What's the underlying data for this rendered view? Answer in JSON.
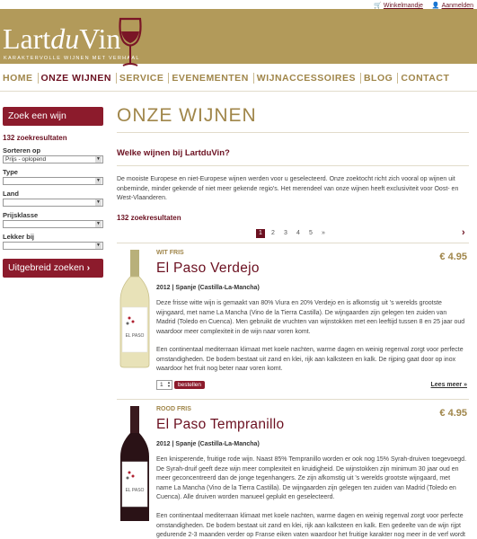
{
  "toplinks": {
    "cart": "Winkelmandje",
    "login": "Aanmelden"
  },
  "logo": {
    "part1": "Lart",
    "part2": "du",
    "part3": "Vin",
    "tagline": "KARAKTERVOLLE WIJNEN MET VERHAAL"
  },
  "nav": [
    "HOME",
    "ONZE WIJNEN",
    "SERVICE",
    "EVENEMENTEN",
    "WIJNACCESSOIRES",
    "BLOG",
    "CONTACT"
  ],
  "nav_active": "ONZE WIJNEN",
  "sidebar": {
    "search_title": "Zoek een wijn",
    "count": "132 zoekresultaten",
    "sort_label": "Sorteren op",
    "sort_value": "Prijs - oplopend",
    "type_label": "Type",
    "land_label": "Land",
    "price_label": "Prijsklasse",
    "lekker_label": "Lekker bij",
    "advanced_button": "Uitgebreid zoeken"
  },
  "main": {
    "title": "ONZE WIJNEN",
    "subtitle": "Welke wijnen bij LartduVin?",
    "intro": "De mooiste Europese en niet-Europese wijnen werden voor u geselecteerd. Onze zoektocht richt zich vooral op wijnen uit onbeminde, minder gekende of niet meer gekende regio's. Het merendeel van onze wijnen heeft exclusiviteit voor Oost- en West-Vlaanderen.",
    "count": "132 zoekresultaten",
    "pages": [
      "1",
      "2",
      "3",
      "4",
      "5",
      "»"
    ],
    "current_page": "1",
    "next_arrow": "›"
  },
  "wines": [
    {
      "category": "WIT FRIS",
      "name": "El Paso Verdejo",
      "price": "€ 4.95",
      "meta": "2012 | Spanje (Castilla-La-Mancha)",
      "desc1": "Deze frisse witte wijn is gemaakt van 80% Viura en 20% Verdejo en is afkomstig uit 's werelds grootste wijngaard, met name La Mancha (Vino de la Tierra Castilla). De wijngaarden zijn gelegen ten zuiden van Madrid (Toledo en Cuenca). Men gebruikt de vruchten van wijnstokken met een leeftijd tussen 8 en 25 jaar oud waardoor meer complexiteit in de wijn naar voren komt.",
      "desc2": "Een continentaal mediterraan klimaat met koele nachten, warme dagen en weinig regenval zorgt voor perfecte omstandigheden. De bodem bestaat uit zand en klei, rijk aan kalksteen en kalk. De rijping gaat door op inox waardoor het fruit nog beter naar voren komt.",
      "qty": "1",
      "order_button": "bestellen",
      "more": "Lees meer »",
      "bottle_color": "#e8e2b8",
      "label_text": "EL PASO"
    },
    {
      "category": "ROOD FRIS",
      "name": "El Paso Tempranillo",
      "price": "€ 4.95",
      "meta": "2012 | Spanje (Castilla-La-Mancha)",
      "desc1": "Een knisperende, fruitige rode wijn. Naast 85% Tempranillo worden er ook nog 15% Syrah-druiven toegevoegd. De Syrah-druif geeft deze wijn meer complexiteit en kruidigheid. De wijnstokken zijn minimum 30 jaar oud en meer geconcentreerd dan de jonge tegenhangers. Ze zijn afkomstig uit 's werelds grootste wijngaard, met name La Mancha (Vino de la Tierra Castilla). De wijngaarden zijn gelegen ten zuiden van Madrid (Toledo en Cuenca). Alle druiven worden manueel geplukt en geselecteerd.",
      "desc2": "Een continentaal mediterraan klimaat met koele nachten, warme dagen en weinig regenval zorgt voor perfecte omstandigheden. De bodem bestaat uit zand en klei, rijk aan kalksteen en kalk. Een gedeelte van de wijn rijpt gedurende 2-3 maanden verder op Franse eiken vaten waardoor het fruitige karakter nog meer in de verf wordt gezet",
      "bottle_color": "#2a1216",
      "label_text": "EL PASO"
    }
  ]
}
